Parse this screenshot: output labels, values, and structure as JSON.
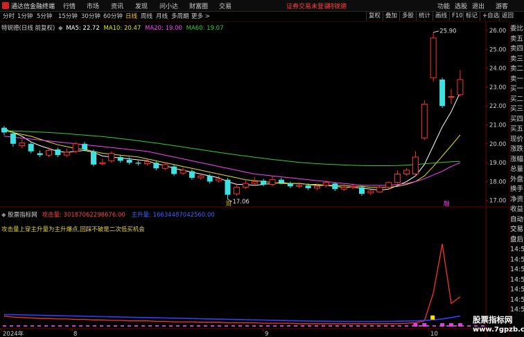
{
  "app": {
    "title": "通达信金融终端",
    "menu": [
      "行情",
      "市场",
      "资讯",
      "发现",
      "问小达",
      "财富圈",
      "交易"
    ],
    "login_warning": "证券交易未登录",
    "stock_name": "特锐德",
    "right_menu": [
      "功能",
      "选股",
      "退出",
      "游客"
    ],
    "window_buttons": [
      "—",
      "□",
      "×"
    ]
  },
  "toolbar": {
    "periods": [
      {
        "label": "分时",
        "active": false
      },
      {
        "label": "1分钟",
        "active": false
      },
      {
        "label": "5分钟",
        "active": false
      },
      {
        "label": "15分钟",
        "active": false
      },
      {
        "label": "30分钟",
        "active": false
      },
      {
        "label": "60分钟",
        "active": false
      },
      {
        "label": "日线",
        "active": true
      },
      {
        "label": "周线",
        "active": false
      },
      {
        "label": "月线",
        "active": false
      },
      {
        "label": "多周期",
        "active": false
      },
      {
        "label": "更多 >",
        "active": false
      }
    ],
    "right_buttons": [
      "复权",
      "叠加",
      "多股",
      "统计",
      "画线",
      "F10",
      "标记",
      "+自选",
      "返回"
    ]
  },
  "chart_header": {
    "stock_label": "特锐德(日线 前复权)",
    "ma": [
      {
        "label": "MA5: 22.72",
        "color": "#ffffff"
      },
      {
        "label": "MA10: 20.47",
        "color": "#e6e600"
      },
      {
        "label": "MA20: 19.00",
        "color": "#ff40ff"
      },
      {
        "label": "MA60: 19.07",
        "color": "#30d030"
      }
    ]
  },
  "indicator_header": {
    "name": "股票指标网",
    "items": [
      {
        "label": "攻击量: 30187062298676.00",
        "color": "#ff4040"
      },
      {
        "label": "主升量: 16634487042560.00",
        "color": "#4060ff"
      }
    ],
    "note": "攻击量上穿主升量为主升爆点,回踩不破是二次低买机会"
  },
  "chart_data": {
    "type": "candlestick",
    "ylim": [
      16.6,
      26.3
    ],
    "y_ticks": [
      "26.00",
      "25.00",
      "24.00",
      "23.00",
      "22.00",
      "21.00",
      "20.00",
      "19.00",
      "18.00",
      "17.00"
    ],
    "x_ticks": [
      "2024年",
      "8",
      "9",
      "10"
    ],
    "annotations": {
      "high": "25.90",
      "low": "17.06",
      "event_markers": [
        "财",
        "融"
      ]
    },
    "candles": [
      {
        "o": 20.85,
        "c": 20.6,
        "h": 20.95,
        "l": 20.45
      },
      {
        "o": 20.55,
        "c": 20.0,
        "h": 20.7,
        "l": 19.85
      },
      {
        "o": 19.9,
        "c": 20.05,
        "h": 20.25,
        "l": 19.75
      },
      {
        "o": 20.0,
        "c": 19.6,
        "h": 20.1,
        "l": 19.5
      },
      {
        "o": 19.5,
        "c": 19.4,
        "h": 19.65,
        "l": 19.3
      },
      {
        "o": 19.4,
        "c": 19.65,
        "h": 19.8,
        "l": 19.3
      },
      {
        "o": 19.7,
        "c": 19.4,
        "h": 19.8,
        "l": 19.3
      },
      {
        "o": 19.4,
        "c": 19.55,
        "h": 19.75,
        "l": 19.3
      },
      {
        "o": 19.6,
        "c": 20.0,
        "h": 20.1,
        "l": 19.5
      },
      {
        "o": 20.0,
        "c": 19.7,
        "h": 20.1,
        "l": 19.6
      },
      {
        "o": 19.6,
        "c": 18.9,
        "h": 19.7,
        "l": 18.8
      },
      {
        "o": 18.95,
        "c": 19.0,
        "h": 19.2,
        "l": 18.85
      },
      {
        "o": 19.1,
        "c": 19.5,
        "h": 19.6,
        "l": 19.0
      },
      {
        "o": 19.3,
        "c": 19.1,
        "h": 19.4,
        "l": 19.0
      },
      {
        "o": 19.15,
        "c": 19.0,
        "h": 19.3,
        "l": 18.9
      },
      {
        "o": 19.0,
        "c": 18.95,
        "h": 19.1,
        "l": 18.85
      },
      {
        "o": 18.95,
        "c": 19.05,
        "h": 19.2,
        "l": 18.85
      },
      {
        "o": 19.0,
        "c": 18.7,
        "h": 19.1,
        "l": 18.6
      },
      {
        "o": 18.7,
        "c": 18.9,
        "h": 19.0,
        "l": 18.6
      },
      {
        "o": 18.8,
        "c": 18.4,
        "h": 18.9,
        "l": 18.3
      },
      {
        "o": 18.45,
        "c": 18.6,
        "h": 18.75,
        "l": 18.35
      },
      {
        "o": 18.55,
        "c": 18.2,
        "h": 18.65,
        "l": 18.1
      },
      {
        "o": 18.2,
        "c": 18.3,
        "h": 18.45,
        "l": 18.1
      },
      {
        "o": 18.3,
        "c": 18.0,
        "h": 18.4,
        "l": 17.9
      },
      {
        "o": 18.05,
        "c": 18.15,
        "h": 18.3,
        "l": 17.95
      },
      {
        "o": 18.1,
        "c": 17.3,
        "h": 18.2,
        "l": 17.06
      },
      {
        "o": 17.35,
        "c": 17.7,
        "h": 17.9,
        "l": 17.25
      },
      {
        "o": 17.7,
        "c": 17.9,
        "h": 18.1,
        "l": 17.6
      },
      {
        "o": 17.9,
        "c": 18.0,
        "h": 18.25,
        "l": 17.8
      },
      {
        "o": 18.05,
        "c": 17.85,
        "h": 18.15,
        "l": 17.75
      },
      {
        "o": 17.85,
        "c": 18.1,
        "h": 18.3,
        "l": 17.75
      },
      {
        "o": 18.1,
        "c": 17.95,
        "h": 18.2,
        "l": 17.85
      },
      {
        "o": 17.9,
        "c": 17.75,
        "h": 18.0,
        "l": 17.65
      },
      {
        "o": 17.75,
        "c": 17.8,
        "h": 17.95,
        "l": 17.65
      },
      {
        "o": 17.8,
        "c": 17.65,
        "h": 17.9,
        "l": 17.55
      },
      {
        "o": 17.65,
        "c": 17.75,
        "h": 17.9,
        "l": 17.55
      },
      {
        "o": 17.8,
        "c": 17.95,
        "h": 18.05,
        "l": 17.7
      },
      {
        "o": 17.9,
        "c": 17.6,
        "h": 17.95,
        "l": 17.5
      },
      {
        "o": 17.6,
        "c": 17.7,
        "h": 17.85,
        "l": 17.5
      },
      {
        "o": 17.7,
        "c": 17.75,
        "h": 17.9,
        "l": 17.6
      },
      {
        "o": 17.7,
        "c": 17.35,
        "h": 17.8,
        "l": 17.25
      },
      {
        "o": 17.4,
        "c": 17.5,
        "h": 17.6,
        "l": 17.3
      },
      {
        "o": 17.45,
        "c": 17.7,
        "h": 17.8,
        "l": 17.4
      },
      {
        "o": 17.7,
        "c": 17.95,
        "h": 18.0,
        "l": 17.6
      },
      {
        "o": 17.95,
        "c": 18.4,
        "h": 18.6,
        "l": 17.9
      },
      {
        "o": 18.4,
        "c": 18.6,
        "h": 18.7,
        "l": 18.3
      },
      {
        "o": 18.4,
        "c": 19.3,
        "h": 19.6,
        "l": 18.3
      },
      {
        "o": 20.3,
        "c": 22.1,
        "h": 22.3,
        "l": 20.2
      },
      {
        "o": 23.5,
        "c": 25.6,
        "h": 25.9,
        "l": 23.3
      },
      {
        "o": 23.4,
        "c": 22.0,
        "h": 23.5,
        "l": 21.9
      },
      {
        "o": 22.5,
        "c": 22.5,
        "h": 22.9,
        "l": 22.1
      },
      {
        "o": 22.6,
        "c": 23.4,
        "h": 23.9,
        "l": 22.5
      }
    ],
    "series": [
      {
        "name": "MA5",
        "color": "#ffffff",
        "values": [
          20.8,
          20.6,
          20.4,
          20.1,
          19.9,
          19.75,
          19.6,
          19.55,
          19.6,
          19.65,
          19.55,
          19.35,
          19.3,
          19.25,
          19.2,
          19.15,
          19.1,
          18.95,
          18.85,
          18.7,
          18.6,
          18.5,
          18.4,
          18.3,
          18.2,
          18.0,
          17.85,
          17.85,
          17.8,
          17.85,
          17.9,
          17.95,
          17.9,
          17.9,
          17.85,
          17.8,
          17.8,
          17.75,
          17.7,
          17.7,
          17.65,
          17.6,
          17.55,
          17.6,
          17.8,
          18.0,
          18.3,
          18.9,
          19.9,
          20.9,
          21.7,
          22.72
        ]
      },
      {
        "name": "MA10",
        "color": "#e6e600",
        "values": [
          20.7,
          20.6,
          20.5,
          20.4,
          20.25,
          20.1,
          19.95,
          19.85,
          19.75,
          19.7,
          19.6,
          19.5,
          19.45,
          19.4,
          19.35,
          19.3,
          19.2,
          19.1,
          19.0,
          18.9,
          18.8,
          18.7,
          18.6,
          18.5,
          18.4,
          18.3,
          18.2,
          18.1,
          18.05,
          18.0,
          17.95,
          17.9,
          17.9,
          17.9,
          17.85,
          17.85,
          17.8,
          17.8,
          17.8,
          17.75,
          17.75,
          17.7,
          17.7,
          17.7,
          17.75,
          17.85,
          18.0,
          18.3,
          18.8,
          19.35,
          19.9,
          20.47
        ]
      },
      {
        "name": "MA20",
        "color": "#ff40ff",
        "values": [
          20.4,
          20.35,
          20.3,
          20.25,
          20.2,
          20.15,
          20.1,
          20.05,
          20.0,
          19.95,
          19.9,
          19.85,
          19.8,
          19.75,
          19.7,
          19.65,
          19.6,
          19.5,
          19.4,
          19.3,
          19.2,
          19.1,
          19.0,
          18.9,
          18.8,
          18.7,
          18.6,
          18.5,
          18.4,
          18.35,
          18.3,
          18.25,
          18.2,
          18.15,
          18.1,
          18.05,
          18.0,
          17.95,
          17.9,
          17.85,
          17.8,
          17.8,
          17.8,
          17.8,
          17.85,
          17.9,
          18.0,
          18.15,
          18.35,
          18.55,
          18.8,
          19.0
        ]
      },
      {
        "name": "MA60",
        "color": "#30d030",
        "values": [
          20.7,
          20.68,
          20.66,
          20.64,
          20.62,
          20.6,
          20.57,
          20.54,
          20.5,
          20.46,
          20.42,
          20.38,
          20.33,
          20.28,
          20.22,
          20.16,
          20.1,
          20.04,
          19.97,
          19.9,
          19.83,
          19.76,
          19.69,
          19.62,
          19.55,
          19.48,
          19.41,
          19.35,
          19.29,
          19.23,
          19.17,
          19.12,
          19.07,
          19.02,
          18.98,
          18.95,
          18.92,
          18.9,
          18.88,
          18.86,
          18.85,
          18.84,
          18.84,
          18.84,
          18.85,
          18.87,
          18.9,
          18.94,
          18.98,
          19.02,
          19.05,
          19.07
        ]
      }
    ],
    "indicator": {
      "ylim": [
        0,
        10
      ],
      "series": [
        {
          "name": "攻击量",
          "color": "#ff3030",
          "values": [
            1.1,
            1.0,
            0.95,
            0.9,
            0.85,
            0.85,
            0.8,
            0.8,
            0.75,
            0.75,
            0.7,
            0.7,
            0.65,
            0.65,
            0.6,
            0.6,
            0.6,
            0.55,
            0.55,
            0.5,
            0.5,
            0.5,
            0.45,
            0.45,
            0.45,
            0.4,
            0.4,
            0.4,
            0.4,
            0.35,
            0.35,
            0.35,
            0.35,
            0.3,
            0.3,
            0.3,
            0.3,
            0.3,
            0.3,
            0.3,
            0.3,
            0.3,
            0.3,
            0.3,
            0.3,
            0.35,
            0.4,
            0.6,
            3.5,
            8.6,
            2.4,
            3.1
          ]
        },
        {
          "name": "主升量",
          "color": "#3040ff",
          "values": [
            1.25,
            1.25,
            1.22,
            1.2,
            1.18,
            1.16,
            1.14,
            1.12,
            1.1,
            1.08,
            1.06,
            1.04,
            1.02,
            1.0,
            0.98,
            0.96,
            0.94,
            0.92,
            0.9,
            0.88,
            0.86,
            0.84,
            0.82,
            0.8,
            0.78,
            0.76,
            0.74,
            0.72,
            0.7,
            0.68,
            0.66,
            0.64,
            0.62,
            0.6,
            0.58,
            0.57,
            0.56,
            0.55,
            0.55,
            0.54,
            0.54,
            0.54,
            0.54,
            0.55,
            0.56,
            0.58,
            0.6,
            0.64,
            0.7,
            0.8,
            0.95,
            1.1
          ]
        }
      ]
    }
  },
  "right_panel": [
    "委比",
    "卖五",
    "卖四",
    "卖三",
    "卖二",
    "卖一",
    "买一",
    "买二",
    "买三",
    "买四",
    "买五",
    "现价",
    "涨跌",
    "涨幅",
    "总量",
    "外盘",
    "换手",
    "净资",
    "收益",
    "自动",
    "交易",
    "盘后",
    "14:50",
    "14:50",
    "14:50",
    "14:50",
    "14:50",
    "14:50",
    "14:50"
  ],
  "watermark": {
    "title": "股票指标网",
    "url": "www.7gpzb.com"
  }
}
